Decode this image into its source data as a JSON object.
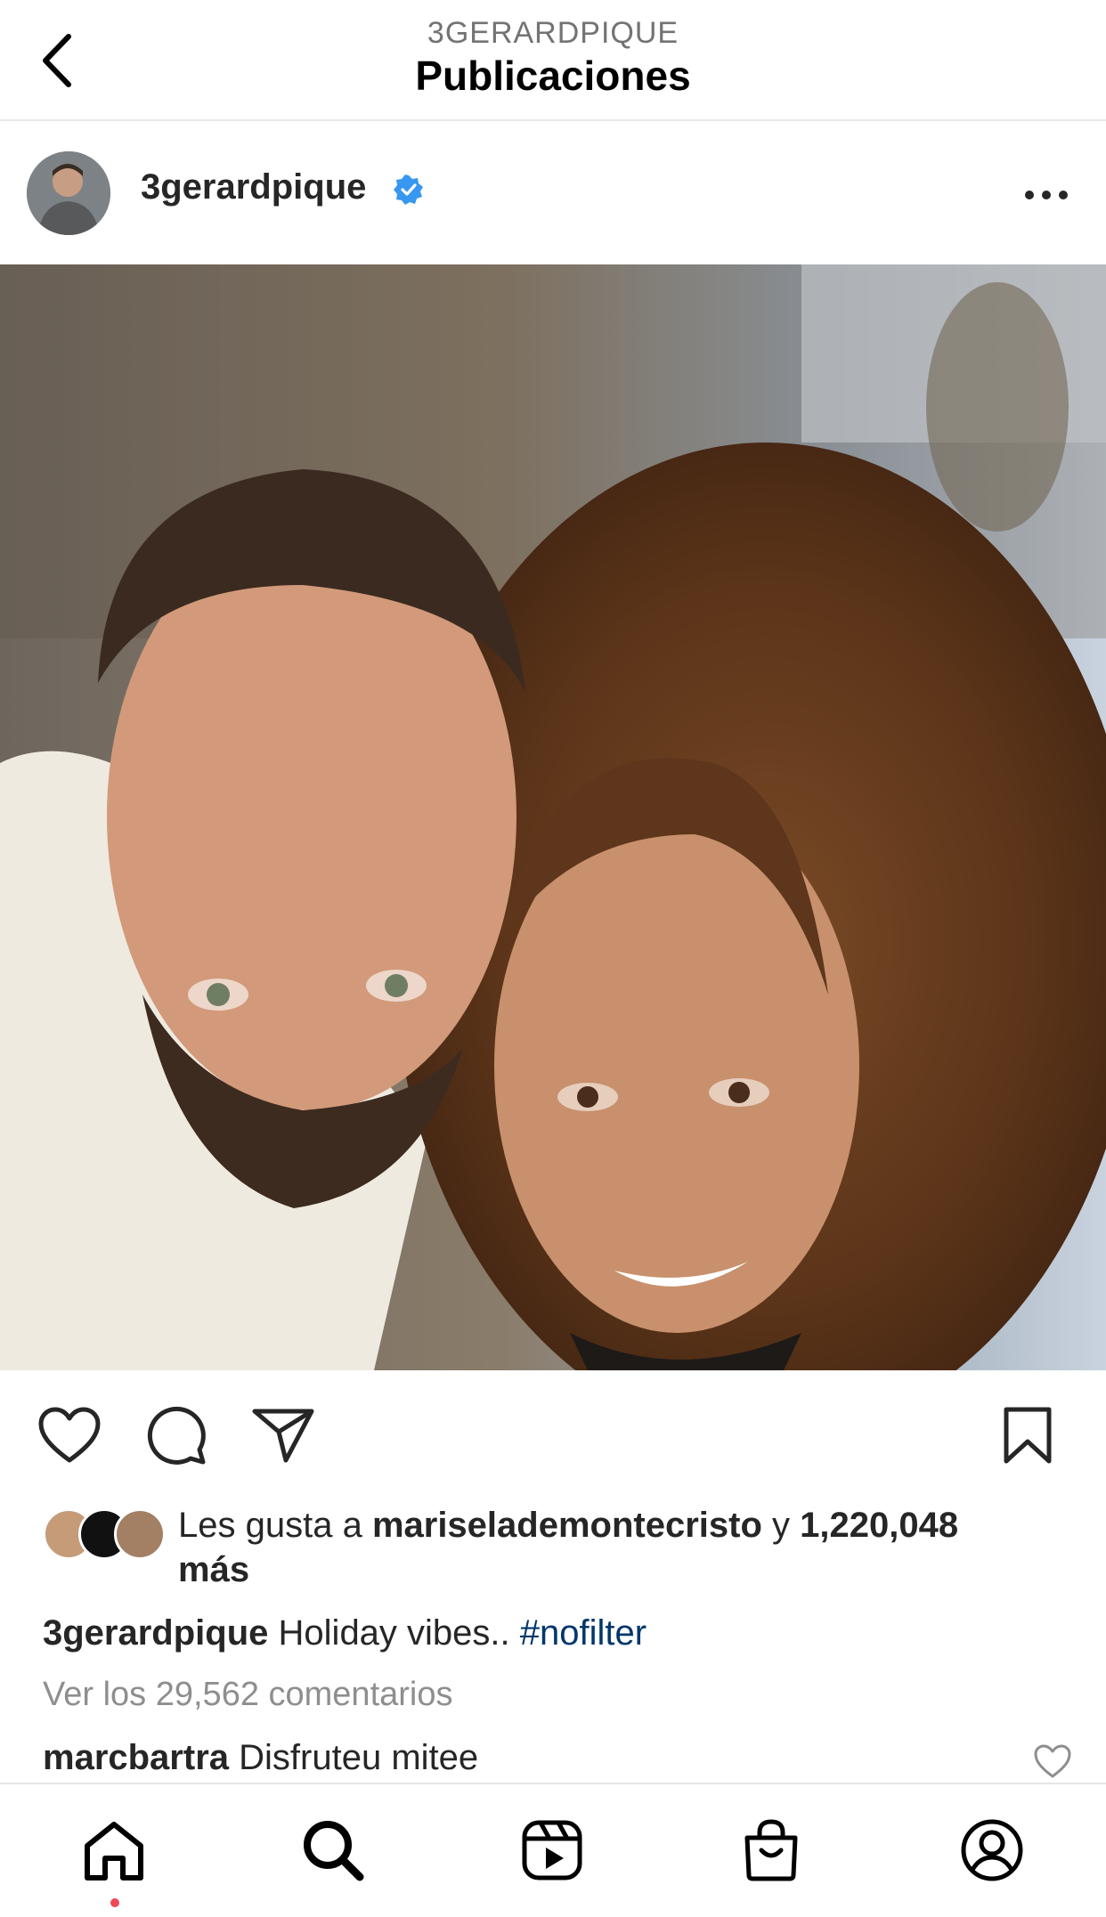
{
  "header": {
    "account": "3GERARDPIQUE",
    "title": "Publicaciones"
  },
  "post": {
    "username": "3gerardpique",
    "verified": true,
    "likes": {
      "prefix": "Les gusta a ",
      "user": "mariselademontecristo",
      "connector": " y ",
      "count": "1,220,048",
      "suffix": "más"
    },
    "caption": {
      "user": "3gerardpique",
      "text": "Holiday vibes.. ",
      "hashtag": "#nofilter"
    },
    "view_comments": "Ver los 29,562 comentarios",
    "comment": {
      "user": "marcbartra",
      "text": "Disfruteu mitee"
    }
  },
  "icons": {
    "back": "chevron-left-icon",
    "more": "more-horizontal-icon",
    "like": "heart-icon",
    "comment": "comment-icon",
    "share": "paper-plane-icon",
    "save": "bookmark-icon",
    "nav": [
      "home-icon",
      "search-icon",
      "reels-icon",
      "shop-icon",
      "profile-icon"
    ]
  },
  "colors": {
    "verified": "#3897f0",
    "hashtag": "#00376b",
    "notification_dot": "#ed4956",
    "secondary_text": "#8e8e8e"
  }
}
